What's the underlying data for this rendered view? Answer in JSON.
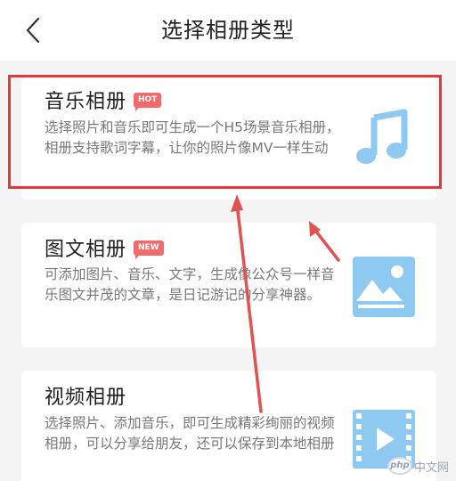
{
  "header": {
    "title": "选择相册类型",
    "back_icon": "chevron-left-icon"
  },
  "cards": [
    {
      "title": "音乐相册",
      "badge": "HOT",
      "description": "选择照片和音乐即可生成一个H5场景音乐相册，相册支持歌词字幕，让你的照片像MV一样生动",
      "icon": "music-note-icon",
      "highlighted": true
    },
    {
      "title": "图文相册",
      "badge": "NEW",
      "description": "可添加图片、音乐、文字，生成像公众号一样音乐图文并茂的文章，是日记游记的分享神器。",
      "icon": "image-icon",
      "highlighted": false
    },
    {
      "title": "视频相册",
      "badge": "",
      "description": "选择照片、添加音乐，即可生成精彩绚丽的视频相册，可以分享给朋友，还可以保存到本地相册",
      "icon": "video-play-icon",
      "highlighted": false
    }
  ],
  "colors": {
    "accent_icon": "#8ec9f2",
    "badge": "#f26a6a",
    "highlight_border": "#e23a3a"
  },
  "watermark": {
    "logo": "php",
    "text": "中文网"
  }
}
